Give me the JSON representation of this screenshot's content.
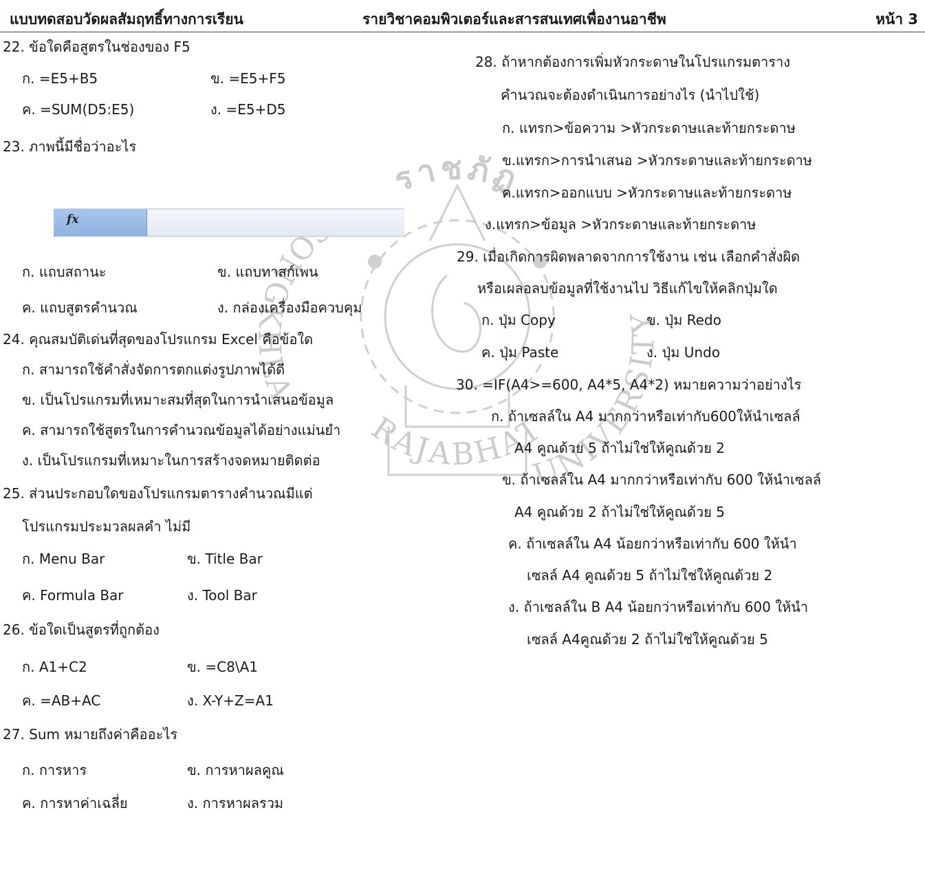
{
  "header": {
    "left": "แบบทดสอบวัดผลสัมฤทธิ์ทางการเรียน",
    "middle": "รายวิชาคอมพิวเตอร์และสารสนเทศเพื่องานอาชีพ",
    "right": "หน้า 3"
  },
  "questions": {
    "q22": {
      "text": "22. ข้อใดคือสูตรในช่องของ F5",
      "a": "ก. =E5+B5",
      "b": "ข. =E5+F5",
      "c": "ค. =SUM(D5:E5)",
      "d": "ง. =E5+D5"
    },
    "q23": {
      "text": "23. ภาพนี้มีชื่อว่าอะไร",
      "a": "ก. แถบสถานะ",
      "b": "ข. แถบทาสก์เพน",
      "c": "ค. แถบสูตรคำนวณ",
      "d": "ง. กล่องเครื่องมือควบคุม"
    },
    "q24": {
      "text": "24. คุณสมบัติเด่นที่สุดของโปรแกรม Excel คือข้อใด",
      "a": "ก. สามารถใช้คำสั่งจัดการตกแต่งรูปภาพได้ดี",
      "b": "ข. เป็นโปรแกรมที่เหมาะสมที่สุดในการนำเสนอข้อมูล",
      "c": "ค. สามารถใช้สูตรในการคำนวณข้อมูลได้อย่างแม่นยำ",
      "d": "ง. เป็นโปรแกรมที่เหมาะในการสร้างจดหมายติดต่อ"
    },
    "q25": {
      "line1": "25. ส่วนประกอบใดของโปรแกรมตารางคำนวณมีแต่",
      "line2": "โปรแกรมประมวลผลคำ ไม่มี",
      "a": "ก. Menu Bar",
      "b": "ข. Title Bar",
      "c": "ค. Formula Bar",
      "d": "ง. Tool Bar"
    },
    "q26": {
      "text": "26. ข้อใดเป็นสูตรที่ถูกต้อง",
      "a": "ก. A1+C2",
      "b": "ข. =C8\\A1",
      "c": "ค. =AB+AC",
      "d": "ง. X-Y+Z=A1"
    },
    "q27": {
      "text": "27.  Sum หมายถึงค่าคืออะไร",
      "a": "ก. การหาร",
      "b": "ข. การหาผลคูณ",
      "c": "ค. การหาค่าเฉลี่ย",
      "d": "ง. การหาผลรวม"
    },
    "q28": {
      "line1": "28. ถ้าหากต้องการเพิ่มหัวกระดาษในโปรแกรมตาราง",
      "line2": "คำนวณจะต้องดำเนินการอย่างไร (นำไปใช้)",
      "a": "ก. แทรก>ข้อความ >หัวกระดาษและท้ายกระดาษ",
      "b": "ข.แทรก>การนำเสนอ >หัวกระดาษและท้ายกระดาษ",
      "c": "ค.แทรก>ออกแบบ >หัวกระดาษและท้ายกระดาษ",
      "d": "ง.แทรก>ข้อมูล >หัวกระดาษและท้ายกระดาษ"
    },
    "q29": {
      "line1": "29. เมื่อเกิดการผิดพลาดจากการใช้งาน เช่น เลือกคำสั่งผิด",
      "line2": "หรือเผลอลบข้อมูลที่ใช้งานไป วิธีแก้ไขให้คลิกปุ่มใด",
      "a": "ก. ปุ่ม Copy",
      "b": "ข.  ปุ่ม Redo",
      "c": "ค. ปุ่ม Paste",
      "d": "ง.  ปุ่ม Undo"
    },
    "q30": {
      "text": "30. =IF(A4>=600, A4*5, A4*2) หมายความว่าอย่างไร",
      "a1": "ก. ถ้าเซลล์ใน A4 มากกว่าหรือเท่ากับ600ให้นำเซลล์",
      "a2": "A4 คูณด้วย 5 ถ้าไม่ใช่ให้คูณด้วย 2",
      "b1": "ข. ถ้าเซลล์ใน A4 มากกว่าหรือเท่ากับ 600 ให้นำเซลล์",
      "b2": "A4 คูณด้วย 2 ถ้าไม่ใช่ให้คูณด้วย 5",
      "c1": "ค. ถ้าเซลล์ใน A4 น้อยกว่าหรือเท่ากับ 600 ให้นำ",
      "c2": "เซลล์ A4 คูณด้วย 5 ถ้าไม่ใช่ให้คูณด้วย 2",
      "d1": "ง. ถ้าเซลล์ใน B A4 น้อยกว่าหรือเท่ากับ 600 ให้นำ",
      "d2": "เซลล์ A4คูณด้วย 2 ถ้าไม่ใช่ให้คูณด้วย 5"
    }
  },
  "formula_bar": {
    "icon": "fx-icon",
    "label": "fx"
  },
  "watermark": {
    "top_text": "ราชภัฏ",
    "left_text": "SONGKHLA",
    "bottom_text": "RAJABHAT",
    "right_text": "UNIVERSITY"
  },
  "colors": {
    "fx_box": "#9dbbe6",
    "watermark": "#c9c9c9"
  }
}
